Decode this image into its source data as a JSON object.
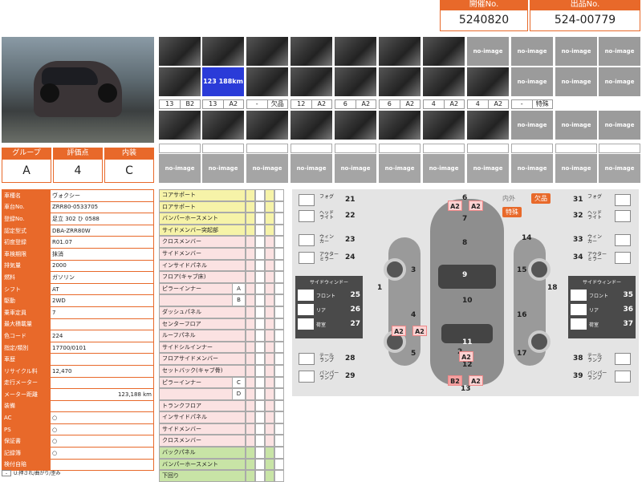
{
  "header": {
    "lot_label": "開催No.",
    "lot_value": "5240820",
    "item_label": "出品No.",
    "item_value": "524-00779"
  },
  "photos_row1": [
    "photo",
    "photo",
    "photo",
    "photo",
    "photo",
    "photo",
    "photo",
    "no-image",
    "no-image",
    "no-image",
    "no-image"
  ],
  "photos_row2": [
    "photo",
    "123 188km",
    "photo",
    "photo",
    "photo",
    "photo",
    "photo",
    "photo",
    "no-image",
    "no-image",
    "no-image"
  ],
  "tags_row": [
    [
      "13",
      "B2"
    ],
    [
      "13",
      "A2"
    ],
    [
      "-",
      "欠品"
    ],
    [
      "12",
      "A2"
    ],
    [
      "6",
      "A2"
    ],
    [
      "6",
      "A2"
    ],
    [
      "4",
      "A2"
    ],
    [
      "4",
      "A2"
    ],
    [
      "-",
      "特殊"
    ]
  ],
  "photos_row3": [
    "photo",
    "photo",
    "photo",
    "photo",
    "photo",
    "photo",
    "photo",
    "photo",
    "no-image",
    "no-image",
    "no-image"
  ],
  "photos_row4": [
    "no-image",
    "no-image",
    "no-image",
    "no-image",
    "no-image",
    "no-image",
    "no-image",
    "no-image",
    "no-image",
    "no-image",
    "no-image"
  ],
  "grade": {
    "group_label": "グループ",
    "group_value": "A",
    "score_label": "評価点",
    "score_value": "4",
    "interior_label": "内装",
    "interior_value": "C"
  },
  "info": [
    {
      "label": "車種名",
      "value": "ヴォクシー"
    },
    {
      "label": "車台No.",
      "value": "ZRR80-0533705"
    },
    {
      "label": "登録No.",
      "value": "足立 302 ひ 0588"
    },
    {
      "label": "認定型式",
      "value": "DBA-ZRR80W"
    },
    {
      "label": "初度登録",
      "value": "R01.07"
    },
    {
      "label": "車検期限",
      "value": "抹消"
    },
    {
      "label": "排気量",
      "value": "2000"
    },
    {
      "label": "燃料",
      "value": "ガソリン"
    },
    {
      "label": "シフト",
      "value": "AT"
    },
    {
      "label": "駆動",
      "value": "2WD"
    },
    {
      "label": "乗車定員",
      "value": "7"
    },
    {
      "label": "最大積載量",
      "value": ""
    },
    {
      "label": "色コード",
      "value": "224"
    },
    {
      "label": "指定/類別",
      "value": "17700/0101"
    },
    {
      "label": "車歴",
      "value": ""
    },
    {
      "label": "リサイクル料",
      "value": "12,470"
    },
    {
      "label": "走行メーター",
      "value": ""
    },
    {
      "label": "メーター距離",
      "value": "123,188 km"
    },
    {
      "label": "装備",
      "value": ""
    },
    {
      "label": "AC",
      "value": "○"
    },
    {
      "label": "PS",
      "value": "○"
    },
    {
      "label": "保証書",
      "value": "○"
    },
    {
      "label": "記録簿",
      "value": "○"
    },
    {
      "label": "検付自賠",
      "value": ""
    }
  ],
  "frame_rows": [
    {
      "label": "コアサポート",
      "color": "y",
      "sub": ""
    },
    {
      "label": "ロアサポート",
      "color": "y",
      "sub": ""
    },
    {
      "label": "バンパーホースメント",
      "color": "y",
      "sub": ""
    },
    {
      "label": "サイドメンバー突起部",
      "color": "y",
      "sub": ""
    },
    {
      "label": "クロスメンバー",
      "color": "p",
      "sub": ""
    },
    {
      "label": "サイドメンバー",
      "color": "p",
      "sub": ""
    },
    {
      "label": "インサイドパネル",
      "color": "p",
      "sub": ""
    },
    {
      "label": "フロア(キャブ床)",
      "color": "p",
      "sub": ""
    },
    {
      "label": "ピラーインナー",
      "color": "p",
      "sub": "A"
    },
    {
      "label": "",
      "color": "p",
      "sub": "B"
    },
    {
      "label": "ダッシュパネル",
      "color": "p",
      "sub": ""
    },
    {
      "label": "センターフロア",
      "color": "p",
      "sub": ""
    },
    {
      "label": "ルーフパネル",
      "color": "p",
      "sub": ""
    },
    {
      "label": "サイドシルインナー",
      "color": "p",
      "sub": ""
    },
    {
      "label": "フロアサイドメンバー",
      "color": "p",
      "sub": ""
    },
    {
      "label": "セットバック(キャブ骨)",
      "color": "p",
      "sub": ""
    },
    {
      "label": "ピラーインナー",
      "color": "p",
      "sub": "C"
    },
    {
      "label": "",
      "color": "p",
      "sub": "D"
    },
    {
      "label": "トランクフロア",
      "color": "p",
      "sub": ""
    },
    {
      "label": "インサイドパネル",
      "color": "p",
      "sub": ""
    },
    {
      "label": "サイドメンバー",
      "color": "p",
      "sub": ""
    },
    {
      "label": "クロスメンバー",
      "color": "p",
      "sub": ""
    },
    {
      "label": "バックパネル",
      "color": "g",
      "sub": ""
    },
    {
      "label": "バンパーホースメント",
      "color": "g",
      "sub": ""
    },
    {
      "label": "下回り",
      "color": "g",
      "sub": ""
    }
  ],
  "diagram": {
    "interior_ext": "内外",
    "missing": "欠品",
    "special": "特殊",
    "side_window_title": "サイドウィンドー",
    "left_lights": [
      {
        "num": "21",
        "label": "フォグ"
      },
      {
        "num": "22",
        "label": "ヘッド\nライト"
      },
      {
        "num": "23",
        "label": "ウィン\nカー"
      },
      {
        "num": "24",
        "label": "アウター\nミラー"
      },
      {
        "num": "28",
        "label": "テール\nランプ"
      },
      {
        "num": "29",
        "label": "バンパー\nランプ"
      }
    ],
    "right_lights": [
      {
        "num": "31",
        "label": "フォグ"
      },
      {
        "num": "32",
        "label": "ヘッド\nライト"
      },
      {
        "num": "33",
        "label": "ウィン\nカー"
      },
      {
        "num": "34",
        "label": "アウター\nミラー"
      },
      {
        "num": "38",
        "label": "テール\nランプ"
      },
      {
        "num": "39",
        "label": "バンパー\nランプ"
      }
    ],
    "left_windows": [
      {
        "num": "25",
        "label": "フロント"
      },
      {
        "num": "26",
        "label": "リア"
      },
      {
        "num": "27",
        "label": "荷室"
      }
    ],
    "right_windows": [
      {
        "num": "35",
        "label": "フロント"
      },
      {
        "num": "36",
        "label": "リア"
      },
      {
        "num": "37",
        "label": "荷室"
      }
    ],
    "panel_numbers": [
      "1",
      "2",
      "3",
      "4",
      "5",
      "6",
      "7",
      "8",
      "9",
      "10",
      "11",
      "12",
      "13",
      "14",
      "15",
      "16",
      "17",
      "18"
    ],
    "badges": {
      "front_a": "A2",
      "front_b": "A2",
      "left_a": "A2",
      "left_b": "A2",
      "rear_a": "A2",
      "rear_b": "B2",
      "rear_c": "A2"
    }
  },
  "legend": "U:押され/曲がり/歪み",
  "legend_minus": "-"
}
